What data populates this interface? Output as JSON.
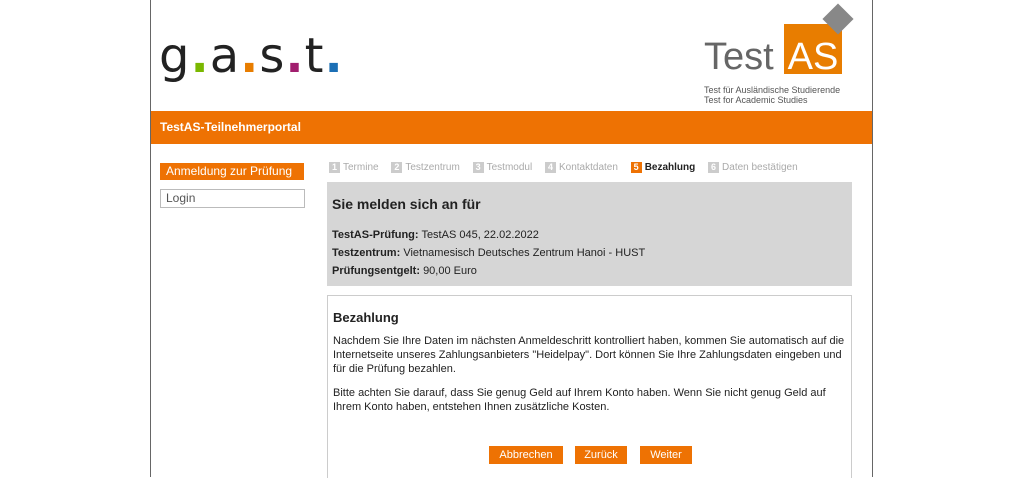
{
  "header": {
    "gast_logo": {
      "g": "g",
      "a": "a",
      "s": "s",
      "t": "t",
      "dot": "."
    },
    "testas_logo": {
      "test": "Test",
      "as": "AS",
      "subtitle_de": "Test für Ausländische Studierende",
      "subtitle_en": "Test for Academic Studies"
    },
    "portal_title": "TestAS-Teilnehmerportal"
  },
  "sidebar": {
    "items": [
      {
        "label": "Anmeldung zur Prüfung"
      },
      {
        "label": "Login"
      }
    ]
  },
  "steps": [
    {
      "num": "1",
      "label": "Termine"
    },
    {
      "num": "2",
      "label": "Testzentrum"
    },
    {
      "num": "3",
      "label": "Testmodul"
    },
    {
      "num": "4",
      "label": "Kontaktdaten"
    },
    {
      "num": "5",
      "label": "Bezahlung"
    },
    {
      "num": "6",
      "label": "Daten bestätigen"
    }
  ],
  "summary": {
    "title": "Sie melden sich an für",
    "rows": [
      {
        "label": "TestAS-Prüfung:",
        "value": "TestAS 045, 22.02.2022"
      },
      {
        "label": "Testzentrum:",
        "value": "Vietnamesisch Deutsches Zentrum Hanoi - HUST"
      },
      {
        "label": "Prüfungsentgelt:",
        "value": "90,00 Euro"
      }
    ]
  },
  "payment": {
    "title": "Bezahlung",
    "para1": "Nachdem Sie Ihre Daten im nächsten Anmeldeschritt kontrolliert haben, kommen Sie automatisch auf die Internetseite unseres Zahlungsanbieters \"Heidelpay\". Dort können Sie Ihre Zahlungsdaten eingeben und für die Prüfung bezahlen.",
    "para2": "Bitte achten Sie darauf, dass Sie genug Geld auf Ihrem Konto haben. Wenn Sie nicht genug Geld auf Ihrem Konto haben, entstehen Ihnen zusätzliche Kosten."
  },
  "buttons": {
    "cancel": "Abbrechen",
    "back": "Zurück",
    "next": "Weiter"
  },
  "colors": {
    "accent": "#ee7203",
    "summary_bg": "#d6d6d6"
  }
}
